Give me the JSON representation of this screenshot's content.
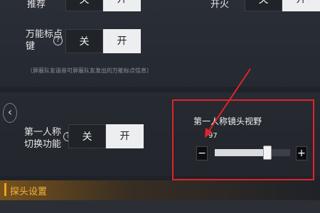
{
  "top_row": {
    "left_label": "推荐",
    "left_toggle": {
      "off": "关",
      "on": "开"
    },
    "right_label": "开火",
    "right_toggle": {
      "off": "关",
      "on": "开"
    }
  },
  "universal_marker": {
    "label_line1": "万能标点",
    "label_line2": "键",
    "help": "?",
    "toggle": {
      "off": "关",
      "on": "开"
    },
    "hint": "（屏蔽队友语音可屏蔽队友发出的万能标点信息）"
  },
  "first_person_switch": {
    "label_line1": "第一人称",
    "label_line2": "切换功能",
    "help": "?",
    "toggle": {
      "off": "关",
      "on": "开"
    }
  },
  "fov": {
    "title": "第一人称镜头视野",
    "value": "97",
    "minus": "−",
    "plus": "+",
    "slider_fraction": 0.7
  },
  "back_icon": "‹",
  "section": {
    "title": "探头设置"
  },
  "colors": {
    "highlight": "#e0232a",
    "accent": "#f0a020"
  }
}
